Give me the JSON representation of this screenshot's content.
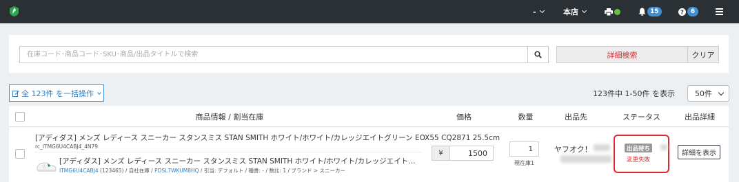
{
  "topbar": {
    "account_label": "-",
    "store_label": "本店",
    "notifications_count": "15",
    "help_count": "6"
  },
  "search": {
    "placeholder": "在庫コード･商品コード･SKU･商品/出品タイトルで検索",
    "advanced_label": "詳細検索",
    "clear_label": "クリア"
  },
  "toolbar": {
    "bulk_label": "全 123件 を一括操作",
    "count_text": "123件中 1-50件 を表示",
    "per_page": "50件"
  },
  "table": {
    "headers": [
      "商品情報 / 割当在庫",
      "価格",
      "数量",
      "出品先",
      "ステータス",
      "出品詳細"
    ],
    "rows": [
      {
        "product_title": "[アディダス] メンズ レディース スニーカー スタンスミス STAN SMITH ホワイト/ホワイト/カレッジエイトグリーン EOX55 CQ2871 25.5cm",
        "product_code": "rc_ITMG6U4CABJ4_4N79",
        "sku_title": "[アディダス] メンズ レディース スニーカー スタンスミス STAN SMITH ホワイト/ホワイト/カレッジエイトグリーン EOX55 CQ2871 2...",
        "meta_item_code": "ITMG6U4CABJ4",
        "meta_mid": "(123465) / 自社在庫 /",
        "meta_sku_code": "PDSL7WKUM8HQ",
        "meta_tail": "/ 引当: デフォルト / 種書: - / 数比: 1 / ブランド > スニーカー",
        "price_prefix": "¥",
        "price": "1500",
        "qty": "1",
        "stock_label": "現在庫1",
        "channel": "ヤフオク！",
        "status_badge": "出品待ち",
        "status_error": "変更失敗",
        "detail_label": "詳細を表示"
      }
    ]
  },
  "colors": {
    "topbar": "#2b3035",
    "accent_blue": "#3f8fd2",
    "danger_red": "#e0282e",
    "status_gray": "#999999",
    "online_green": "#66c23a"
  },
  "icons": [
    "logo-icon",
    "chevron-down-icon",
    "printer-icon",
    "bell-icon",
    "question-icon",
    "menu-icon",
    "search-icon",
    "edit-icon",
    "sneaker-thumbnail"
  ]
}
